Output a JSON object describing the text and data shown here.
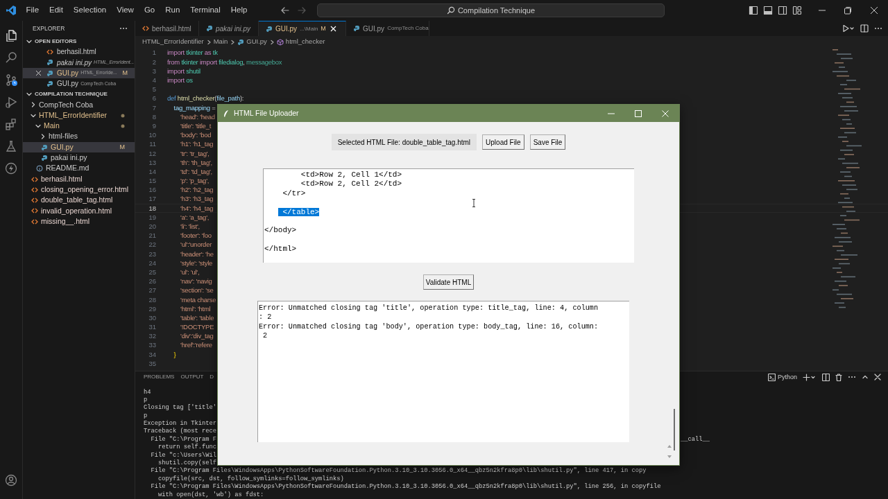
{
  "title_bar": {
    "menu": [
      "File",
      "Edit",
      "Selection",
      "View",
      "Go",
      "Run",
      "Terminal",
      "Help"
    ],
    "search": "Compilation Technique"
  },
  "activity_bar": [
    {
      "kind": "explorer",
      "selected": true
    },
    {
      "kind": "search",
      "selected": false
    },
    {
      "kind": "source_control",
      "selected": false
    },
    {
      "kind": "run",
      "selected": false
    },
    {
      "kind": "extensions",
      "selected": false
    },
    {
      "kind": "testing",
      "selected": false
    },
    {
      "kind": "lightning",
      "selected": false
    },
    {
      "kind": "account",
      "selected": false
    }
  ],
  "sidebar": {
    "title": "EXPLORER",
    "open_editors": {
      "title": "OPEN EDITORS",
      "expanded": true,
      "items": [
        {
          "kind": "html",
          "name": "berhasil.html",
          "selected": false,
          "preview": false,
          "modified": false
        },
        {
          "kind": "python",
          "name": "pakai ini.py",
          "description": "HTML_ErrorIdent...",
          "selected": false,
          "preview": true,
          "modified": false
        },
        {
          "kind": "python",
          "name": "GUI.py",
          "description": "HTML_ErrorIde...",
          "badge": "M",
          "selected": true,
          "preview": false,
          "modified": true
        },
        {
          "kind": "python",
          "name": "GUI.py",
          "description": "CompTech Coba",
          "selected": false,
          "preview": false,
          "modified": false
        }
      ]
    },
    "workspace": {
      "title": "COMPILATION TECHNIQUE",
      "expanded": true,
      "tree": [
        {
          "kind": "folder",
          "name": "CompTech Coba",
          "expanded": false,
          "selected": false,
          "modified": false
        },
        {
          "kind": "folder",
          "name": "HTML_ErrorIdentifier",
          "expanded": true,
          "selected": false,
          "modified": true,
          "children": [
            {
              "kind": "folder",
              "name": "Main",
              "expanded": true,
              "selected": false,
              "modified": true,
              "children": [
                {
                  "kind": "folder",
                  "name": "html-files",
                  "expanded": false,
                  "selected": false,
                  "modified": false
                },
                {
                  "kind": "python",
                  "name": "GUI.py",
                  "badge": "M",
                  "selected": true,
                  "modified": true
                },
                {
                  "kind": "python",
                  "name": "pakai ini.py",
                  "selected": false,
                  "modified": false
                }
              ]
            },
            {
              "kind": "info",
              "name": "README.md",
              "selected": false,
              "modified": false
            }
          ]
        },
        {
          "kind": "html",
          "name": "berhasil.html",
          "selected": false,
          "modified": false
        },
        {
          "kind": "html",
          "name": "closing_opening_error.html",
          "selected": false,
          "modified": false
        },
        {
          "kind": "html",
          "name": "double_table_tag.html",
          "selected": false,
          "modified": false
        },
        {
          "kind": "html",
          "name": "invalid_operation.html",
          "selected": false,
          "modified": false
        },
        {
          "kind": "html",
          "name": "missing__.html",
          "selected": false,
          "modified": false
        }
      ]
    }
  },
  "editor": {
    "tabs": [
      {
        "kind": "html",
        "name": "berhasil.html",
        "selected": false,
        "preview": false,
        "modified": false
      },
      {
        "kind": "python",
        "name": "pakai ini.py",
        "selected": false,
        "preview": true,
        "modified": false
      },
      {
        "kind": "python",
        "name": "GUI.py",
        "description": "...\\Main",
        "badge": "M",
        "selected": true,
        "preview": false,
        "modified": true
      },
      {
        "kind": "python",
        "name": "GUI.py",
        "description": "CompTech Coba",
        "selected": false,
        "preview": false,
        "modified": false
      }
    ],
    "breadcrumb": [
      {
        "kind": "folder",
        "text": "HTML_ErrorIdentifier"
      },
      {
        "kind": "folder",
        "text": "Main"
      },
      {
        "kind": "python",
        "text": "GUI.py"
      },
      {
        "kind": "symbol",
        "text": "html_checker"
      }
    ],
    "lines": [
      {
        "number": "1",
        "current": false,
        "tokens": [
          {
            "kind": "keyword",
            "text": "import"
          },
          {
            "kind": "module",
            "text": " tkinter"
          },
          {
            "kind": "keyword",
            "text": " as"
          },
          {
            "kind": "module",
            "text": " tk"
          }
        ]
      },
      {
        "number": "2",
        "current": false,
        "tokens": [
          {
            "kind": "keyword",
            "text": "from"
          },
          {
            "kind": "module",
            "text": " tkinter"
          },
          {
            "kind": "keyword",
            "text": " import"
          },
          {
            "kind": "module",
            "text": " filedialog"
          },
          {
            "kind": "plain",
            "text": ", "
          },
          {
            "kind": "class",
            "text": "messagebox"
          }
        ]
      },
      {
        "number": "3",
        "current": false,
        "tokens": [
          {
            "kind": "keyword",
            "text": "import"
          },
          {
            "kind": "module",
            "text": " shutil"
          }
        ]
      },
      {
        "number": "4",
        "current": false,
        "tokens": [
          {
            "kind": "keyword",
            "text": "import"
          },
          {
            "kind": "module",
            "text": " os"
          }
        ]
      },
      {
        "number": "5",
        "current": false
      },
      {
        "number": "6",
        "current": false,
        "tokens": [
          {
            "kind": "storage",
            "text": "def"
          },
          {
            "kind": "func",
            "text": " html_checker"
          },
          {
            "kind": "plain",
            "text": "("
          },
          {
            "kind": "param",
            "text": "file_path"
          },
          {
            "kind": "plain",
            "text": "):"
          }
        ]
      },
      {
        "number": "7",
        "current": false,
        "tokens": [
          {
            "kind": "param",
            "text": "    tag_mapping"
          },
          {
            "kind": "plain",
            "text": " ="
          }
        ]
      },
      {
        "number": "8",
        "current": false,
        "tokens": [
          {
            "kind": "string",
            "text": "        'head': 'head"
          }
        ]
      },
      {
        "number": "9",
        "current": false,
        "tokens": [
          {
            "kind": "string",
            "text": "        'title': 'title_t"
          }
        ]
      },
      {
        "number": "10",
        "current": false,
        "tokens": [
          {
            "kind": "string",
            "text": "        'body': 'bod"
          }
        ]
      },
      {
        "number": "11",
        "current": false,
        "tokens": [
          {
            "kind": "string",
            "text": "        'h1': 'h1_tag"
          }
        ]
      },
      {
        "number": "12",
        "current": false,
        "tokens": [
          {
            "kind": "string",
            "text": "        'tr': 'tr_tag',"
          }
        ]
      },
      {
        "number": "13",
        "current": false,
        "tokens": [
          {
            "kind": "string",
            "text": "        'th': 'th_tag',"
          }
        ]
      },
      {
        "number": "14",
        "current": false,
        "tokens": [
          {
            "kind": "string",
            "text": "        'td': 'td_tag',"
          }
        ]
      },
      {
        "number": "15",
        "current": false,
        "tokens": [
          {
            "kind": "string",
            "text": "        'p': 'p_tag',"
          }
        ]
      },
      {
        "number": "16",
        "current": false,
        "tokens": [
          {
            "kind": "string",
            "text": "        'h2': 'h2_tag"
          }
        ]
      },
      {
        "number": "17",
        "current": false,
        "tokens": [
          {
            "kind": "string",
            "text": "        'h3': 'h3_tag"
          }
        ]
      },
      {
        "number": "18",
        "current": true,
        "tokens": [
          {
            "kind": "string",
            "text": "        'h4': 'h4_tag"
          }
        ]
      },
      {
        "number": "19",
        "current": false,
        "tokens": [
          {
            "kind": "string",
            "text": "        'a': 'a_tag',"
          }
        ]
      },
      {
        "number": "20",
        "current": false,
        "tokens": [
          {
            "kind": "string",
            "text": "        'li': 'list',"
          }
        ]
      },
      {
        "number": "21",
        "current": false,
        "tokens": [
          {
            "kind": "string",
            "text": "        'footer': 'foo"
          }
        ]
      },
      {
        "number": "22",
        "current": false,
        "tokens": [
          {
            "kind": "string",
            "text": "        'ul':'unorder"
          }
        ]
      },
      {
        "number": "23",
        "current": false,
        "tokens": [
          {
            "kind": "string",
            "text": "        'header': 'he"
          }
        ]
      },
      {
        "number": "24",
        "current": false,
        "tokens": [
          {
            "kind": "string",
            "text": "        'style': 'style"
          }
        ]
      },
      {
        "number": "25",
        "current": false,
        "tokens": [
          {
            "kind": "string",
            "text": "        'ul': 'ul',"
          }
        ]
      },
      {
        "number": "26",
        "current": false,
        "tokens": [
          {
            "kind": "string",
            "text": "        'nav': 'navig"
          }
        ]
      },
      {
        "number": "27",
        "current": false,
        "tokens": [
          {
            "kind": "string",
            "text": "        'section': 'se"
          }
        ]
      },
      {
        "number": "28",
        "current": false,
        "tokens": [
          {
            "kind": "string",
            "text": "        'meta charse"
          }
        ]
      },
      {
        "number": "29",
        "current": false,
        "tokens": [
          {
            "kind": "string",
            "text": "        'html': 'html"
          }
        ]
      },
      {
        "number": "30",
        "current": false,
        "tokens": [
          {
            "kind": "string",
            "text": "        'table': 'table"
          }
        ]
      },
      {
        "number": "31",
        "current": false,
        "tokens": [
          {
            "kind": "string",
            "text": "        '!DOCTYPE"
          }
        ]
      },
      {
        "number": "32",
        "current": false,
        "tokens": [
          {
            "kind": "string",
            "text": "        'div':'div_tag"
          }
        ]
      },
      {
        "number": "33",
        "current": false,
        "tokens": [
          {
            "kind": "string",
            "text": "        'href':'refere"
          }
        ]
      },
      {
        "number": "34",
        "current": false,
        "tokens": [
          {
            "kind": "bracket",
            "text": "    }"
          }
        ]
      },
      {
        "number": "35",
        "current": false
      }
    ]
  },
  "panel": {
    "tabs": [
      {
        "label": "PROBLEMS",
        "selected": false
      },
      {
        "label": "OUTPUT",
        "selected": false
      },
      {
        "label": "D",
        "selected": false
      }
    ],
    "terminal_name": "Python",
    "lines": [
      {
        "text": "h4"
      },
      {
        "text": "p"
      },
      {
        "text": "Closing tag ['title'"
      },
      {
        "text": "p"
      },
      {
        "text": "Exception in Tkinter"
      },
      {
        "text": "Traceback (most rece"
      },
      {
        "text": "  File \"C:\\Program F",
        "tail": "__call__"
      },
      {
        "text": "    return self.func"
      },
      {
        "text": "  File \"c:\\Users\\Wil"
      },
      {
        "text": "    shutil.copy(self"
      },
      {
        "text": "  File \"C:\\Program Files\\WindowsApps\\PythonSoftwareFoundation.Python.3.10_3.10.3056.0_x64__qbz5n2kfra8p0\\lib\\shutil.py\", line 417, in copy"
      },
      {
        "text": "    copyfile(src, dst, follow_symlinks=follow_symlinks)"
      },
      {
        "text": "  File \"C:\\Program Files\\WindowsApps\\PythonSoftwareFoundation.Python.3.10_3.10.3056.0_x64__qbz5n2kfra8p0\\lib\\shutil.py\", line 256, in copyfile"
      },
      {
        "text": "    with open(dst, 'wb') as fdst:"
      }
    ]
  },
  "dialog": {
    "title": "HTML File Uploader",
    "selected_file": "Selected HTML File: double_table_tag.html",
    "buttons": [
      "Upload File",
      "Save File"
    ],
    "source_lines": [
      {
        "text": "        <td>Row 2, Cell 1</td>",
        "selected": false,
        "gap_before": false
      },
      {
        "text": "        <td>Row 2, Cell 2</td>",
        "selected": false,
        "gap_before": false
      },
      {
        "text": "    </tr>",
        "selected": false,
        "gap_before": false
      },
      {
        "text": "    </table>",
        "selected": true,
        "gap_before": true
      },
      {
        "text": "</body>",
        "selected": false,
        "gap_before": true
      },
      {
        "text": "</html>",
        "selected": false,
        "gap_before": true
      }
    ],
    "validate_button": "Validate HTML",
    "output_lines": [
      "Error: Unmatched closing tag 'title', operation type: title_tag, line: 4, column",
      ": 2",
      "Error: Unmatched closing tag 'body', operation type: body_tag, line: 16, column:",
      " 2"
    ]
  }
}
